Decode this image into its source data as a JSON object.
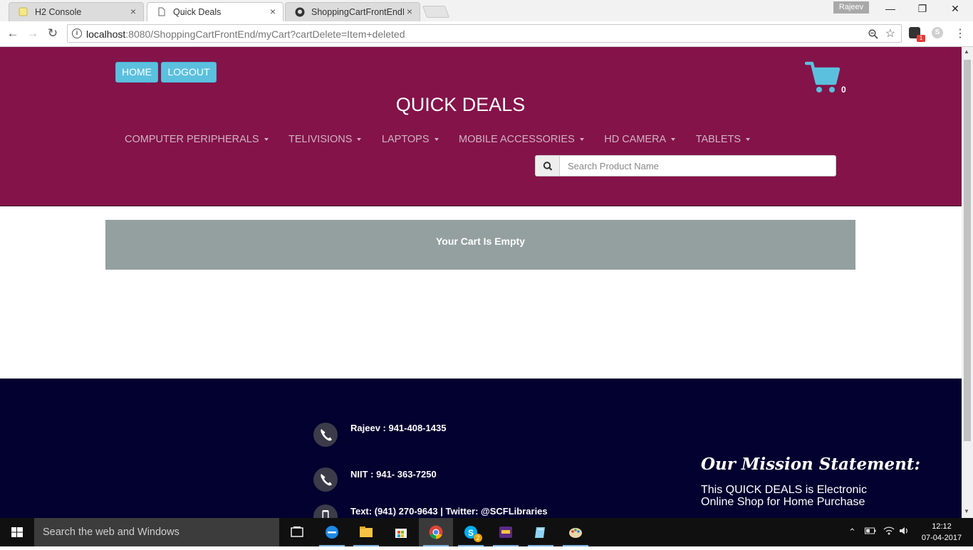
{
  "browser": {
    "tabs": [
      {
        "title": "H2 Console",
        "close": "×"
      },
      {
        "title": "Quick Deals",
        "close": "×"
      },
      {
        "title": "ShoppingCartFrontEndM",
        "close": "×"
      }
    ],
    "profile_name": "Rajeev",
    "window_controls": {
      "minimize": "—",
      "maximize": "❐",
      "close": "✕"
    },
    "url_host": "localhost",
    "url_rest": ":8080/ShoppingCartFrontEnd/myCart?cartDelete=Item+deleted",
    "extension_badge": "1"
  },
  "site": {
    "buttons": {
      "home": "HOME",
      "logout": "LOGOUT"
    },
    "cart_count": "0",
    "title": "QUICK DEALS",
    "categories": [
      "COMPUTER PERIPHERALS",
      "TELIVISIONS",
      "LAPTOPS",
      "MOBILE ACCESSORIES",
      "HD CAMERA",
      "TABLETS"
    ],
    "search_placeholder": "Search Product Name",
    "empty_cart_message": "Your Cart Is Empty",
    "brand_color": "#841349",
    "footer_color": "#02012f"
  },
  "footer": {
    "contacts": [
      {
        "text": "Rajeev : 941-408-1435",
        "icon": "phone-icon"
      },
      {
        "text": "NIIT : 941- 363-7250",
        "icon": "phone-icon"
      },
      {
        "text": "Text: (941) 270-9643 | Twitter: @SCFLibraries",
        "icon": "mobile-icon"
      }
    ],
    "mission_title": "Our Mission Statement:",
    "mission_text": "This QUICK DEALS is Electronic Online Shop for Home Purchase"
  },
  "taskbar": {
    "search_placeholder": "Search the web and Windows",
    "apps": [
      "task-view",
      "edge",
      "file-explorer",
      "store",
      "chrome",
      "skype",
      "game",
      "notes",
      "paint"
    ],
    "skype_badge": "2",
    "time": "12:12",
    "date": "07-04-2017"
  }
}
